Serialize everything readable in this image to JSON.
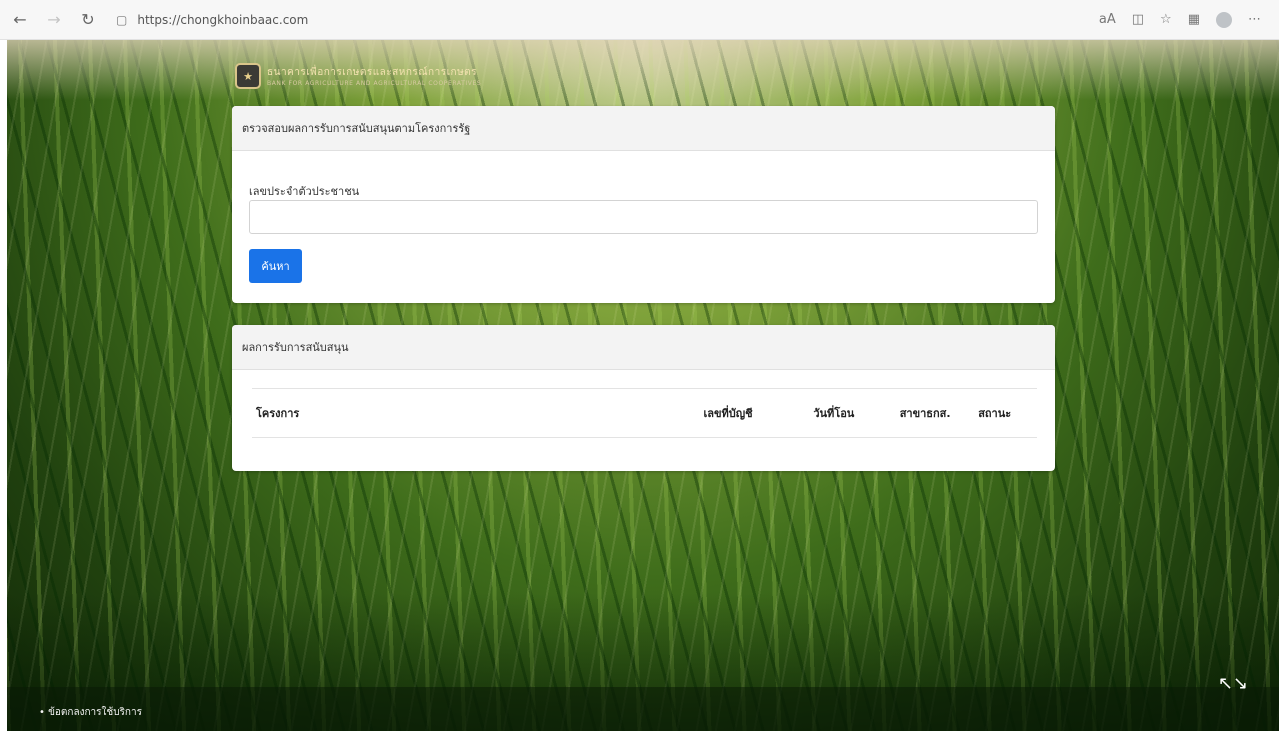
{
  "browser": {
    "url": "https://chongkhoinbaac.com",
    "read_aloud_label": "aA"
  },
  "header": {
    "org_name_th": "ธนาคารเพื่อการเกษตรและสหกรณ์การเกษตร",
    "org_name_en": "BANK FOR AGRICULTURE AND AGRICULTURAL COOPERATIVES"
  },
  "search_card": {
    "title": "ตรวจสอบผลการรับการสนับสนุนตามโครงการรัฐ",
    "id_label": "เลขประจำตัวประชาชน",
    "id_value": "",
    "search_button": "ค้นหา"
  },
  "results_card": {
    "title": "ผลการรับการสนับสนุน",
    "columns": [
      "โครงการ",
      "เลขที่บัญชี",
      "วันที่โอน",
      "สาขาธกส.",
      "สถานะ"
    ]
  },
  "footer": {
    "terms_link": "• ข้อตกลงการใช้บริการ"
  },
  "colors": {
    "primary_button": "#1a73e8"
  }
}
